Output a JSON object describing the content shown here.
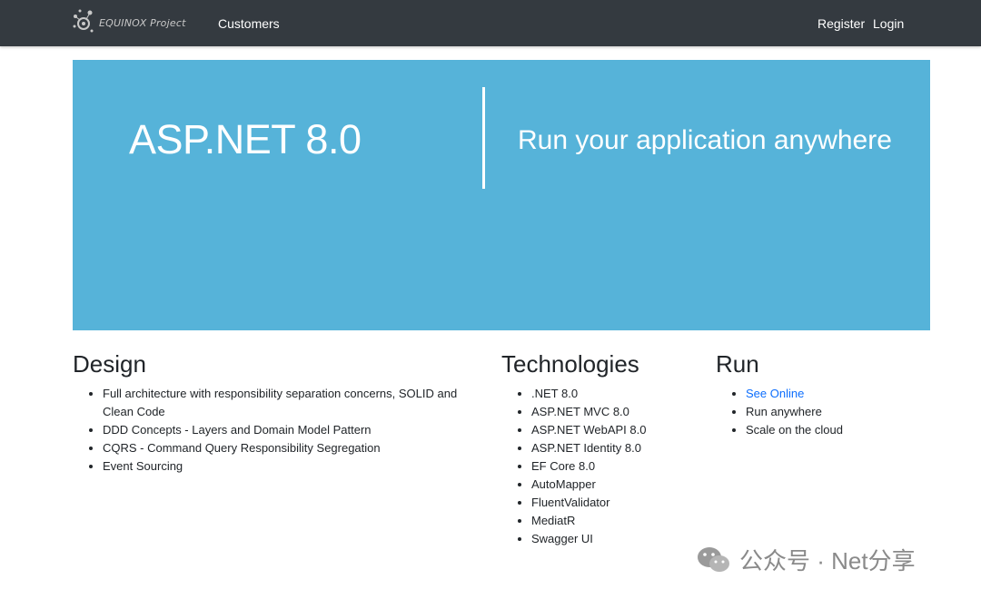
{
  "navbar": {
    "brand_text": "EQUINOX Project",
    "customers": "Customers",
    "register": "Register",
    "login": "Login"
  },
  "hero": {
    "title": "ASP.NET 8.0",
    "subtitle": "Run your application anywhere",
    "background": "#56b3d9"
  },
  "design": {
    "heading": "Design",
    "items": [
      "Full architecture with responsibility separation concerns, SOLID and Clean Code",
      "DDD Concepts - Layers and Domain Model Pattern",
      "CQRS - Command Query Responsibility Segregation",
      "Event Sourcing"
    ]
  },
  "technologies": {
    "heading": "Technologies",
    "items": [
      ".NET 8.0",
      "ASP.NET MVC 8.0",
      "ASP.NET WebAPI 8.0",
      "ASP.NET Identity 8.0",
      "EF Core 8.0",
      "AutoMapper",
      "FluentValidator",
      "MediatR",
      "Swagger UI"
    ]
  },
  "run": {
    "heading": "Run",
    "items": [
      "See Online",
      "Run anywhere",
      "Scale on the cloud"
    ]
  },
  "watermark": {
    "text": "公众号 · Net分享",
    "icon": "wechat-icon"
  },
  "colors": {
    "navbar": "#343a40",
    "link": "#0d6efd"
  }
}
